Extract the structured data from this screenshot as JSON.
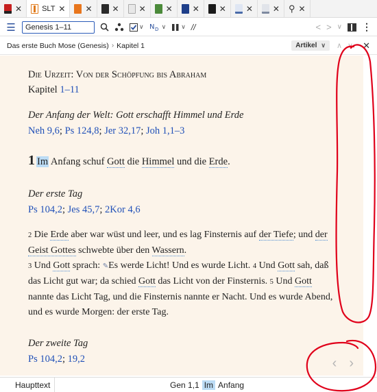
{
  "tabs": [
    {
      "icon": "bible-red-icon",
      "color": "#c62020",
      "label": ""
    },
    {
      "icon": "bible-orange-icon",
      "color": "#e07a1a",
      "label": "SLT",
      "active": true
    },
    {
      "icon": "book-orange-icon",
      "color": "#e8761d",
      "label": ""
    },
    {
      "icon": "book-dark-icon",
      "color": "#2a2a2a",
      "label": ""
    },
    {
      "icon": "book-gray-icon",
      "color": "#9aa0a6",
      "label": ""
    },
    {
      "icon": "book-green-icon",
      "color": "#4b8a3a",
      "label": ""
    },
    {
      "icon": "book-navy-icon",
      "color": "#1f3f8a",
      "label": ""
    },
    {
      "icon": "book-black-icon",
      "color": "#1b1b1b",
      "label": ""
    },
    {
      "icon": "notes-icon",
      "color": "#4a6ba8",
      "label": ""
    },
    {
      "icon": "notes-gray-icon",
      "color": "#7e8aa0",
      "label": ""
    },
    {
      "icon": "search-icon",
      "color": "#333333",
      "label": ""
    }
  ],
  "toolbar": {
    "search_value": "Genesis 1–11"
  },
  "breadcrumb": {
    "book": "Das erste Buch Mose (Genesis)",
    "chapter": "Kapitel 1",
    "view_mode": "Artikel"
  },
  "content": {
    "book_title": "Die Urzeit: Von der Schöpfung bis Abraham",
    "chapter_prefix": "Kapitel ",
    "chapter_range": "1–11",
    "heading1": "Der Anfang der Welt: Gott erschafft Himmel und Erde",
    "refs1": [
      "Neh 9,6",
      "Ps 124,8",
      "Jer 32,17",
      "Joh 1,1–3"
    ],
    "heading2": "Der erste Tag",
    "refs2": [
      "Ps 104,2",
      "Jes 45,7",
      "2Kor 4,6"
    ],
    "heading3": "Der zweite Tag",
    "refs3": [
      "Ps 104,2",
      "19,2"
    ]
  },
  "verse1": {
    "num": "1",
    "w_im": "Im",
    "t1": " Anfang schuf ",
    "w_gott": "Gott",
    "t2": " die ",
    "w_himmel": "Himmel",
    "t3": " und die ",
    "w_erde": "Erde",
    "t4": "."
  },
  "verses": {
    "v2_num": "2",
    "v2_a": " Die ",
    "v2_erde": "Erde",
    "v2_b": " aber war wüst und leer, und es lag Finsternis auf ",
    "v2_tiefe": "der Tiefe",
    "v2_c": "; und ",
    "v2_geist": "der Geist Gottes",
    "v2_d": " schwebte über den ",
    "v2_wassern": "Wassern",
    "v2_e": ".",
    "v3_num": "3",
    "v3_a": " Und ",
    "v3_gott": "Gott",
    "v3_b": " sprach: ",
    "v3_c": "Es werde Licht! Und es wurde Licht. ",
    "v4_num": "4",
    "v4_a": " Und ",
    "v4_gott": "Gott",
    "v4_b": " sah, daß das Licht gut war; da schied ",
    "v4_gott2": "Gott",
    "v4_c": " das Licht von der Finsternis. ",
    "v5_num": "5",
    "v5_a": " Und ",
    "v5_gott": "Gott",
    "v5_b": " nannte das Licht Tag, und die Finsternis nannte er Nacht. Und es wurde Abend, und es wurde Morgen: der erste Tag."
  },
  "statusbar": {
    "left": "Haupttext",
    "ref": "Gen 1,1",
    "word": "Im",
    "next_word": "Anfang"
  },
  "colors": {
    "reader_bg": "#fcf4ea",
    "link": "#2050b8",
    "highlight": "#bcdcf5",
    "annotation": "#e0001a"
  }
}
